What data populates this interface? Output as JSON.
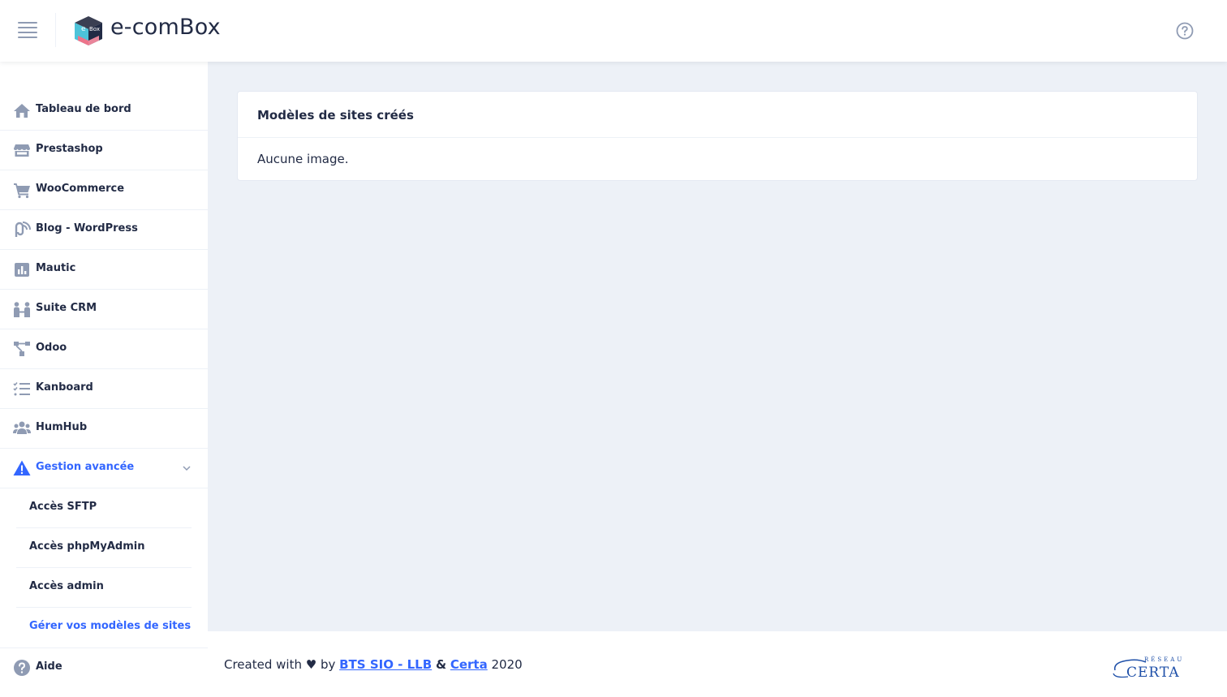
{
  "header": {
    "brand": "e-comBox",
    "logo_text": "Box"
  },
  "sidebar": {
    "items": [
      {
        "label": "Tableau de bord",
        "icon": "home-icon"
      },
      {
        "label": "Prestashop",
        "icon": "store-icon"
      },
      {
        "label": "WooCommerce",
        "icon": "cart-icon"
      },
      {
        "label": "Blog - WordPress",
        "icon": "rss-icon"
      },
      {
        "label": "Mautic",
        "icon": "bar-chart-icon"
      },
      {
        "label": "Suite CRM",
        "icon": "people-link-icon"
      },
      {
        "label": "Odoo",
        "icon": "network-icon"
      },
      {
        "label": "Kanboard",
        "icon": "checklist-icon"
      },
      {
        "label": "HumHub",
        "icon": "group-icon"
      },
      {
        "label": "Gestion avancée",
        "icon": "warning-icon"
      }
    ],
    "sub_items": [
      {
        "label": "Accès SFTP"
      },
      {
        "label": "Accès phpMyAdmin"
      },
      {
        "label": "Accès admin"
      },
      {
        "label": "Gérer vos modèles de sites"
      }
    ],
    "help": {
      "label": "Aide",
      "icon": "question-icon"
    }
  },
  "main": {
    "card_title": "Modèles de sites créés",
    "card_body": "Aucune image."
  },
  "footer": {
    "prefix": "Created with ♥ by",
    "link1": "BTS SIO - LLB",
    "amp": "&",
    "link2": "Certa",
    "year": "2020",
    "logo_top": "RÉSEAU",
    "logo_main": "CERTA"
  },
  "colors": {
    "accent": "#3366ff",
    "text": "#222b45",
    "icon": "#8f9bb3",
    "background": "#edf1f7"
  }
}
